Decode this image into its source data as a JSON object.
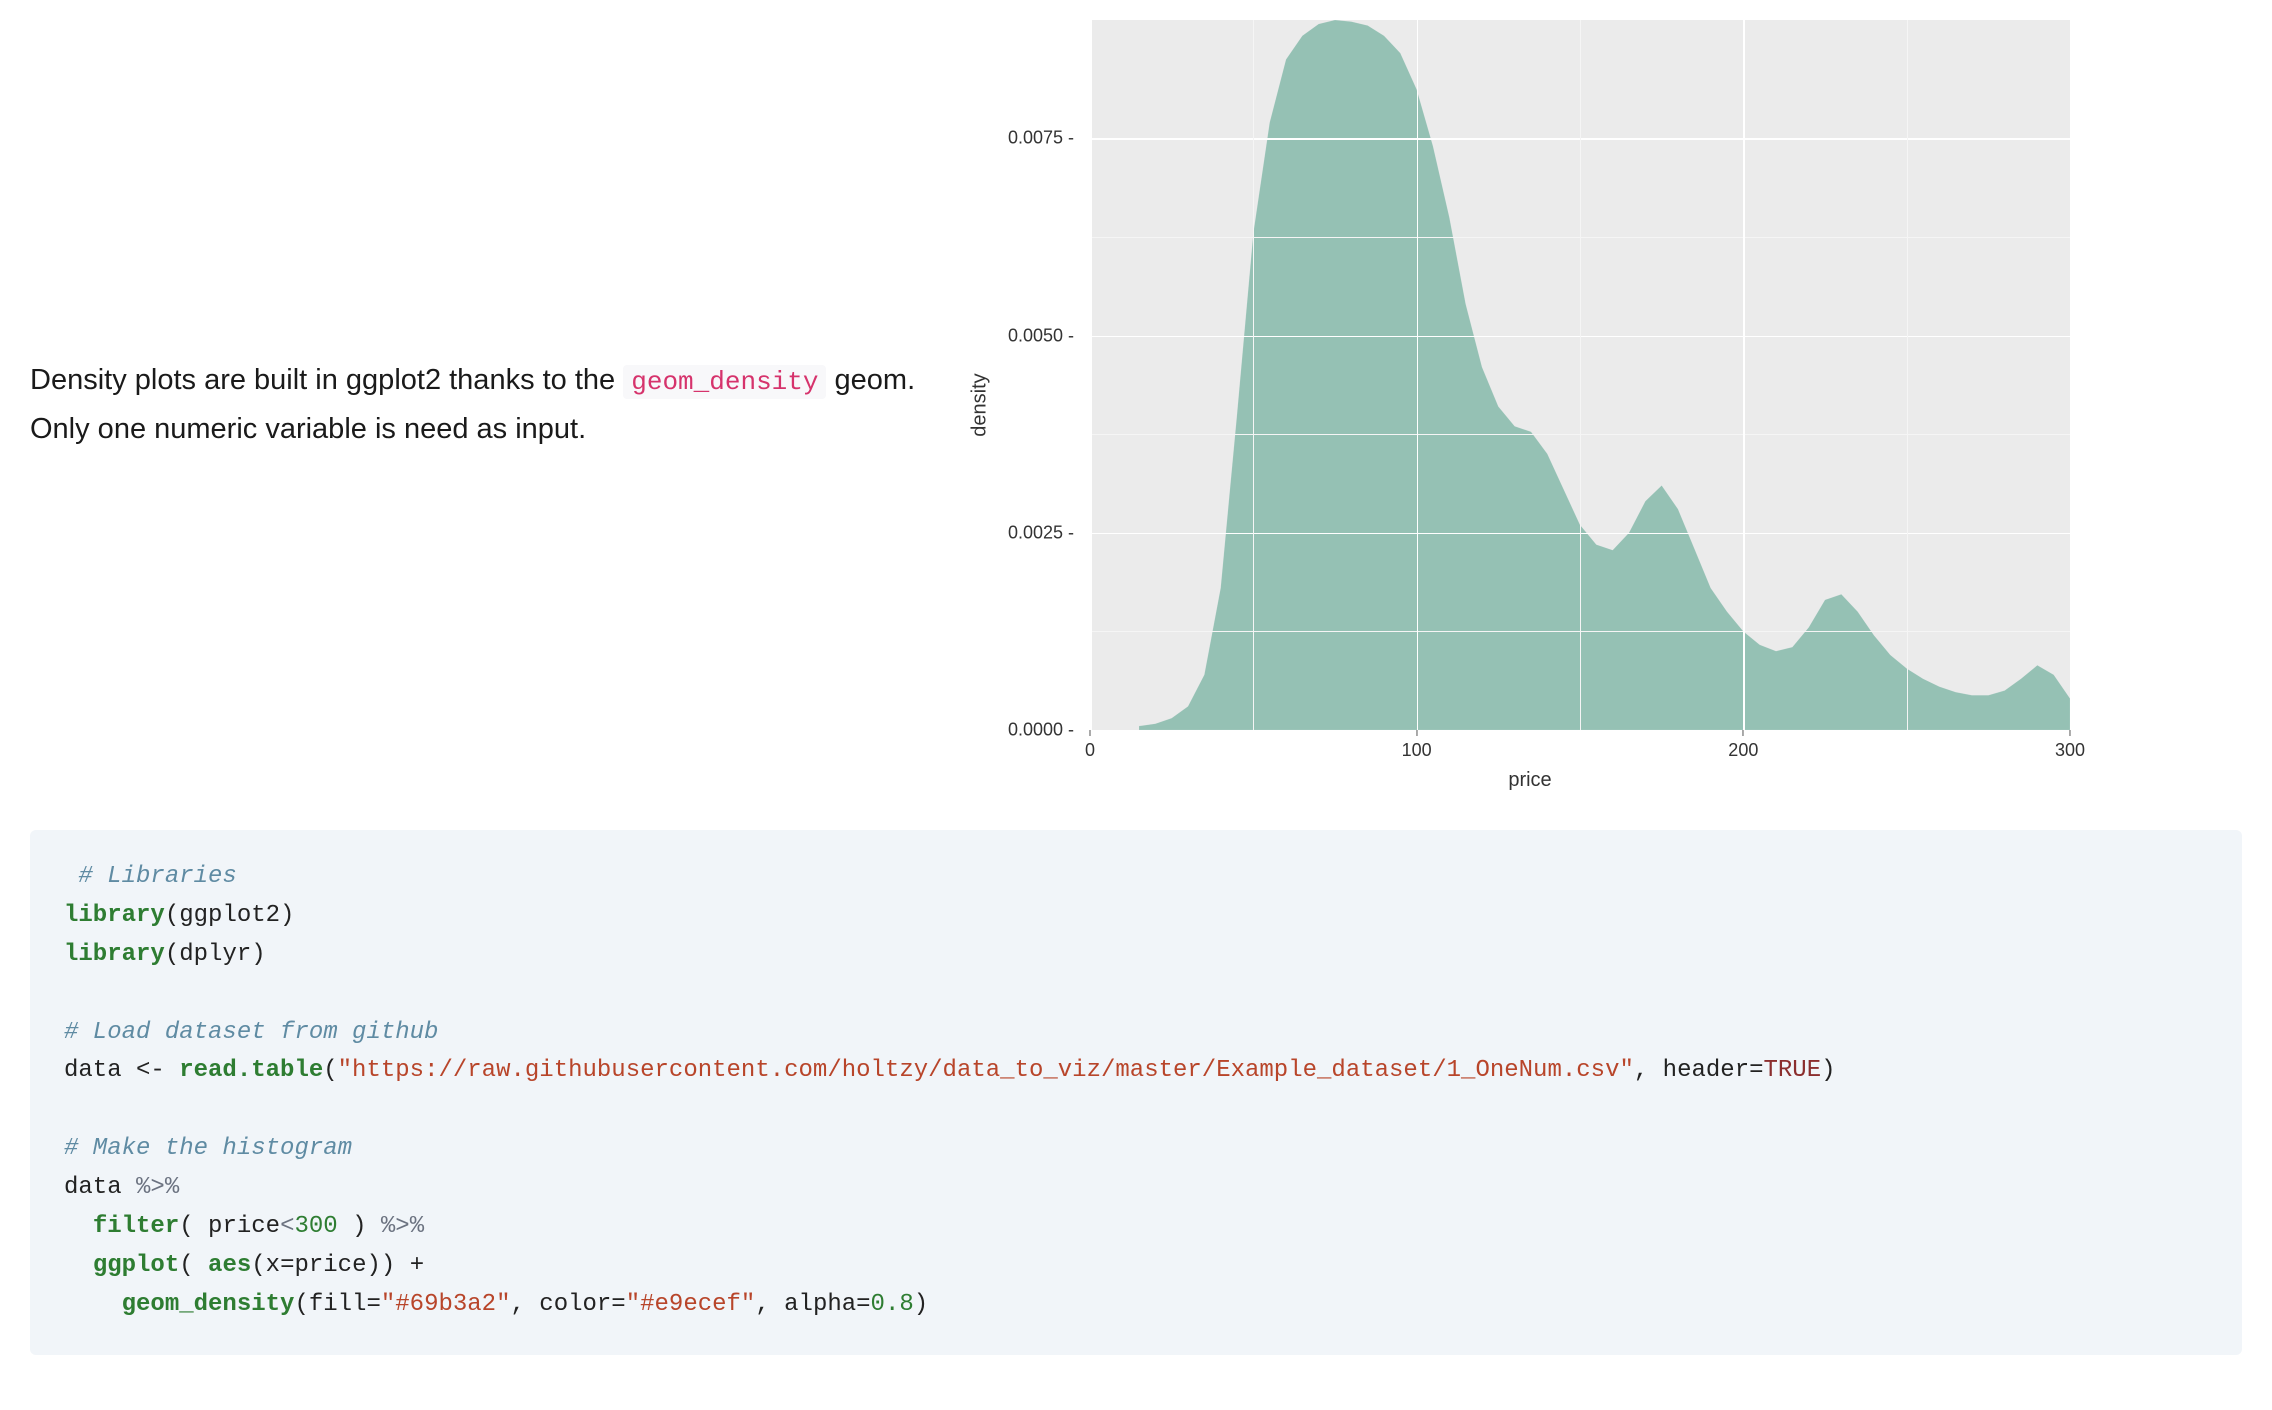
{
  "description": {
    "before_code": "Density plots are built in ggplot2 thanks to the ",
    "inline_code": "geom_density",
    "after_code": " geom. Only one numeric variable is need as input."
  },
  "chart_data": {
    "type": "area",
    "title": "",
    "xlabel": "price",
    "ylabel": "density",
    "xlim": [
      0,
      300
    ],
    "ylim": [
      0,
      0.009
    ],
    "x_ticks": [
      0,
      100,
      200,
      300
    ],
    "y_ticks": [
      0.0,
      0.0025,
      0.005,
      0.0075
    ],
    "y_tick_labels": [
      "0.0000",
      "0.0025",
      "0.0050",
      "0.0075"
    ],
    "fill": "#7fb7a6",
    "fill_opacity": 0.8,
    "stroke": "#e9ecef",
    "grid": true,
    "x": [
      15,
      20,
      25,
      30,
      35,
      40,
      45,
      50,
      55,
      60,
      65,
      70,
      75,
      80,
      85,
      90,
      95,
      100,
      105,
      110,
      115,
      120,
      125,
      130,
      135,
      140,
      145,
      150,
      155,
      160,
      165,
      170,
      175,
      180,
      185,
      190,
      195,
      200,
      205,
      210,
      215,
      220,
      225,
      230,
      235,
      240,
      245,
      250,
      255,
      260,
      265,
      270,
      275,
      280,
      285,
      290,
      295,
      300
    ],
    "y": [
      5e-05,
      8e-05,
      0.00015,
      0.0003,
      0.0007,
      0.0018,
      0.004,
      0.0063,
      0.0077,
      0.0085,
      0.0088,
      0.00895,
      0.009,
      0.00898,
      0.00893,
      0.0088,
      0.00858,
      0.00812,
      0.0074,
      0.0065,
      0.0054,
      0.0046,
      0.0041,
      0.00385,
      0.00378,
      0.0035,
      0.00305,
      0.0026,
      0.00235,
      0.00228,
      0.0025,
      0.0029,
      0.0031,
      0.0028,
      0.0023,
      0.0018,
      0.0015,
      0.00125,
      0.00108,
      0.001,
      0.00105,
      0.0013,
      0.00165,
      0.00172,
      0.0015,
      0.0012,
      0.00095,
      0.00078,
      0.00065,
      0.00055,
      0.00048,
      0.00044,
      0.00044,
      0.0005,
      0.00065,
      0.00082,
      0.0007,
      0.0004
    ]
  },
  "code": {
    "lines": [
      {
        "segments": [
          {
            "text": " # Libraries",
            "cls": "c-comment"
          }
        ]
      },
      {
        "segments": [
          {
            "text": "library",
            "cls": "c-fn"
          },
          {
            "text": "(ggplot2)",
            "cls": "c-plain"
          }
        ]
      },
      {
        "segments": [
          {
            "text": "library",
            "cls": "c-fn"
          },
          {
            "text": "(dplyr)",
            "cls": "c-plain"
          }
        ]
      },
      {
        "segments": [
          {
            "text": "",
            "cls": "c-plain"
          }
        ]
      },
      {
        "segments": [
          {
            "text": "# Load dataset from github",
            "cls": "c-comment"
          }
        ]
      },
      {
        "segments": [
          {
            "text": "data <- ",
            "cls": "c-plain"
          },
          {
            "text": "read.table",
            "cls": "c-fn"
          },
          {
            "text": "(",
            "cls": "c-plain"
          },
          {
            "text": "\"https://raw.githubusercontent.com/holtzy/data_to_viz/master/Example_dataset/1_OneNum.csv\"",
            "cls": "c-str"
          },
          {
            "text": ", header=",
            "cls": "c-plain"
          },
          {
            "text": "TRUE",
            "cls": "c-const"
          },
          {
            "text": ")",
            "cls": "c-plain"
          }
        ]
      },
      {
        "segments": [
          {
            "text": "",
            "cls": "c-plain"
          }
        ]
      },
      {
        "segments": [
          {
            "text": "# Make the histogram",
            "cls": "c-comment"
          }
        ]
      },
      {
        "segments": [
          {
            "text": "data ",
            "cls": "c-plain"
          },
          {
            "text": "%>%",
            "cls": "c-op"
          }
        ]
      },
      {
        "segments": [
          {
            "text": "  ",
            "cls": "c-plain"
          },
          {
            "text": "filter",
            "cls": "c-fn"
          },
          {
            "text": "( price",
            "cls": "c-plain"
          },
          {
            "text": "<",
            "cls": "c-op"
          },
          {
            "text": "300",
            "cls": "c-num"
          },
          {
            "text": " ) ",
            "cls": "c-plain"
          },
          {
            "text": "%>%",
            "cls": "c-op"
          }
        ]
      },
      {
        "segments": [
          {
            "text": "  ",
            "cls": "c-plain"
          },
          {
            "text": "ggplot",
            "cls": "c-fn"
          },
          {
            "text": "( ",
            "cls": "c-plain"
          },
          {
            "text": "aes",
            "cls": "c-fn"
          },
          {
            "text": "(x=price)) +",
            "cls": "c-plain"
          }
        ]
      },
      {
        "segments": [
          {
            "text": "    ",
            "cls": "c-plain"
          },
          {
            "text": "geom_density",
            "cls": "c-fn"
          },
          {
            "text": "(fill=",
            "cls": "c-plain"
          },
          {
            "text": "\"#69b3a2\"",
            "cls": "c-str"
          },
          {
            "text": ", color=",
            "cls": "c-plain"
          },
          {
            "text": "\"#e9ecef\"",
            "cls": "c-str"
          },
          {
            "text": ", alpha=",
            "cls": "c-plain"
          },
          {
            "text": "0.8",
            "cls": "c-num"
          },
          {
            "text": ")",
            "cls": "c-plain"
          }
        ]
      }
    ]
  }
}
